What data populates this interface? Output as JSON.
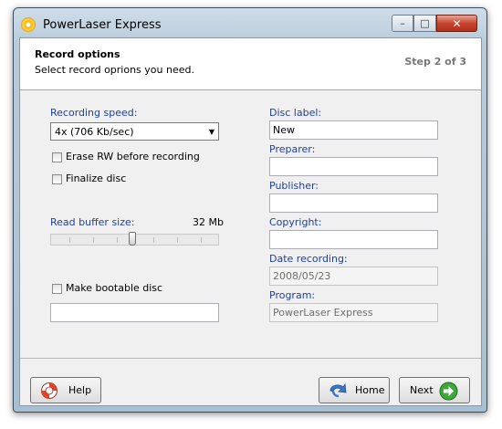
{
  "window": {
    "title": "PowerLaser Express",
    "minimize": "–",
    "maximize": "□",
    "close": "✕"
  },
  "header": {
    "title": "Record options",
    "subtitle": "Select record oprions you need.",
    "step": "Step 2 of 3"
  },
  "left": {
    "recording_speed_label": "Recording speed:",
    "recording_speed_value": "4x (706 Kb/sec)",
    "erase_rw_label": "Erase RW before recording",
    "erase_rw_checked": false,
    "finalize_label": "Finalize disc",
    "finalize_checked": false,
    "read_buffer_label": "Read buffer size:",
    "read_buffer_value": "32 Mb",
    "read_buffer_level_fraction": 0.5,
    "bootable_label": "Make bootable disc",
    "bootable_checked": false,
    "bootable_path": ""
  },
  "right": {
    "disc_label_label": "Disc label:",
    "disc_label_value": "New",
    "preparer_label": "Preparer:",
    "preparer_value": "",
    "publisher_label": "Publisher:",
    "publisher_value": "",
    "copyright_label": "Copyright:",
    "copyright_value": "",
    "date_label": "Date recording:",
    "date_value": "2008/05/23",
    "program_label": "Program:",
    "program_value": "PowerLaser Express"
  },
  "footer": {
    "help_label": "Help",
    "home_label": "Home",
    "next_label": "Next"
  },
  "icons": {
    "app": "disc-icon",
    "help": "lifebuoy-icon",
    "home": "back-arrow-icon",
    "next": "forward-arrow-icon"
  },
  "colors": {
    "label_blue": "#1e3f9e",
    "next_green": "#3ea83a",
    "help_red": "#e0442b"
  }
}
